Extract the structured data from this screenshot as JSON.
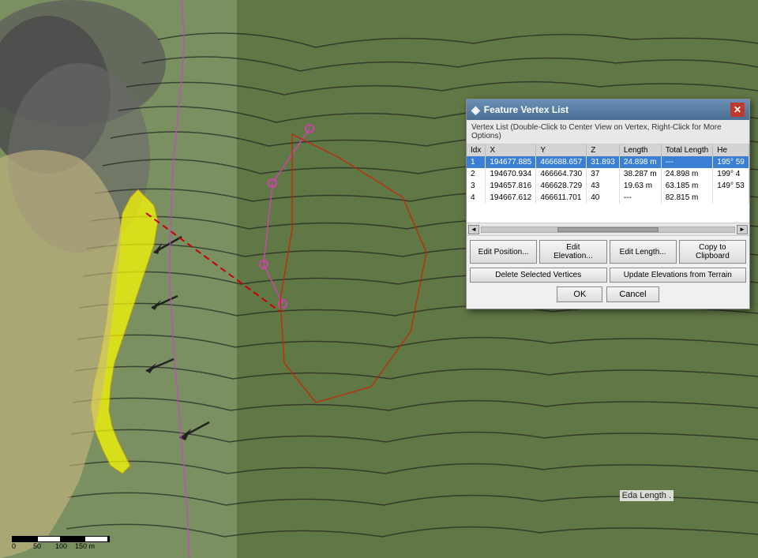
{
  "map": {
    "background_color": "#6b8c5a"
  },
  "dialog": {
    "title": "Feature Vertex List",
    "subtitle": "Vertex List (Double-Click to Center View on Vertex, Right-Click for More Options)",
    "columns": [
      "Idx",
      "X",
      "Y",
      "Z",
      "Length",
      "Total Length",
      "He"
    ],
    "rows": [
      {
        "idx": "1",
        "x": "194677.885",
        "y": "466688.657",
        "z": "31.893",
        "length": "24.898 m",
        "total_length": "---",
        "he": "195° 59",
        "selected": true
      },
      {
        "idx": "2",
        "x": "194670.934",
        "y": "466664.730",
        "z": "37",
        "length": "38.287 m",
        "total_length": "24.898 m",
        "he": "199° 4",
        "selected": false
      },
      {
        "idx": "3",
        "x": "194657.816",
        "y": "466628.729",
        "z": "43",
        "length": "19.63 m",
        "total_length": "63.185 m",
        "he": "149° 53",
        "selected": false
      },
      {
        "idx": "4",
        "x": "194667.612",
        "y": "466611.701",
        "z": "40",
        "length": "---",
        "total_length": "82.815 m",
        "he": "",
        "selected": false
      }
    ],
    "buttons_row1": [
      "Edit Position...",
      "Edit Elevation...",
      "Edit Length...",
      "Copy to Clipboard"
    ],
    "buttons_row2": [
      "Delete Selected Vertices",
      "Update Elevations from Terrain"
    ],
    "buttons_row3": [
      "OK",
      "Cancel"
    ]
  },
  "eda_length": {
    "text": "Eda Length ."
  },
  "icons": {
    "window_icon": "◈",
    "close": "✕",
    "scroll_left": "◄",
    "scroll_right": "►"
  }
}
